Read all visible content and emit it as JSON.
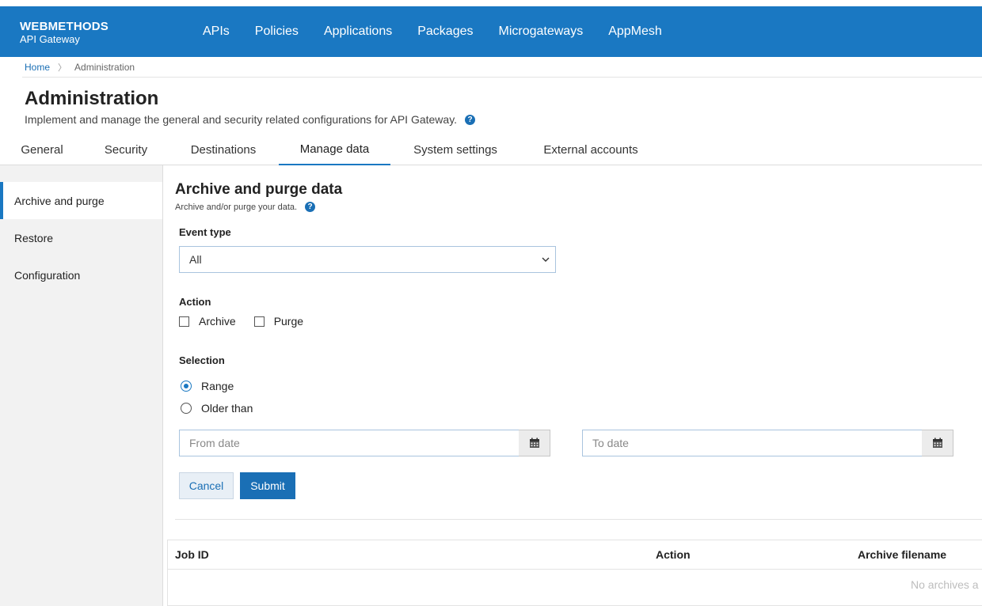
{
  "header": {
    "brand_line1": "WEBMETHODS",
    "brand_line2": "API Gateway",
    "nav": [
      "APIs",
      "Policies",
      "Applications",
      "Packages",
      "Microgateways",
      "AppMesh"
    ]
  },
  "breadcrumb": {
    "home": "Home",
    "separator": "〉",
    "current": "Administration"
  },
  "page": {
    "title": "Administration",
    "description": "Implement and manage the general and security related configurations for API Gateway."
  },
  "tabs": [
    "General",
    "Security",
    "Destinations",
    "Manage data",
    "System settings",
    "External accounts"
  ],
  "active_tab": "Manage data",
  "sidebar": {
    "items": [
      "Archive and purge",
      "Restore",
      "Configuration"
    ],
    "active": "Archive and purge"
  },
  "form": {
    "title": "Archive and purge data",
    "description": "Archive and/or purge your data.",
    "event_type_label": "Event type",
    "event_type_value": "All",
    "action_label": "Action",
    "action_archive": "Archive",
    "action_purge": "Purge",
    "selection_label": "Selection",
    "selection_range": "Range",
    "selection_older": "Older than",
    "selection_value": "Range",
    "from_date_placeholder": "From date",
    "to_date_placeholder": "To date",
    "cancel_label": "Cancel",
    "submit_label": "Submit"
  },
  "table": {
    "columns": [
      "Job ID",
      "Action",
      "Archive filename"
    ],
    "empty_text": "No archives a"
  },
  "colors": {
    "brand_blue": "#1a78c2",
    "link_blue": "#1a6fb5"
  },
  "icons": [
    "help-icon",
    "chevron-down-icon",
    "calendar-icon",
    "checkbox-icon",
    "radio-icon"
  ]
}
